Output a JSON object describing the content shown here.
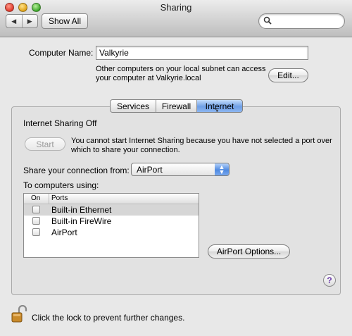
{
  "window": {
    "title": "Sharing",
    "show_all_label": "Show All",
    "nav_back_icon": "◀",
    "nav_forward_icon": "▶",
    "search_icon": "🔍"
  },
  "computer_name": {
    "label": "Computer Name:",
    "value": "Valkyrie",
    "description_line1": "Other computers on your local subnet can access",
    "description_line2": "your computer at Valkyrie.local",
    "edit_label": "Edit..."
  },
  "tabs": [
    {
      "label": "Services"
    },
    {
      "label": "Firewall"
    },
    {
      "label": "Internet"
    }
  ],
  "selected_tab": "Internet",
  "internet": {
    "status": "Internet Sharing Off",
    "start_label": "Start",
    "message_line1": "You cannot start Internet Sharing because you have not selected a port over",
    "message_line2": "which to share your connection.",
    "share_from_label": "Share your connection from:",
    "share_from_value": "AirPort",
    "to_computers_label": "To computers using:",
    "table_headers": {
      "on": "On",
      "ports": "Ports"
    },
    "ports": [
      {
        "name": "Built-in Ethernet",
        "checked": false
      },
      {
        "name": "Built-in FireWire",
        "checked": false
      },
      {
        "name": "AirPort",
        "checked": false
      }
    ],
    "airport_options_label": "AirPort Options...",
    "help_label": "?"
  },
  "footer": {
    "lock_text": "Click the lock to prevent further changes."
  },
  "colors": {
    "selected_tab": "#7aa7ec",
    "help_mark": "#6a3aa8",
    "lock": "#c98a2a"
  }
}
